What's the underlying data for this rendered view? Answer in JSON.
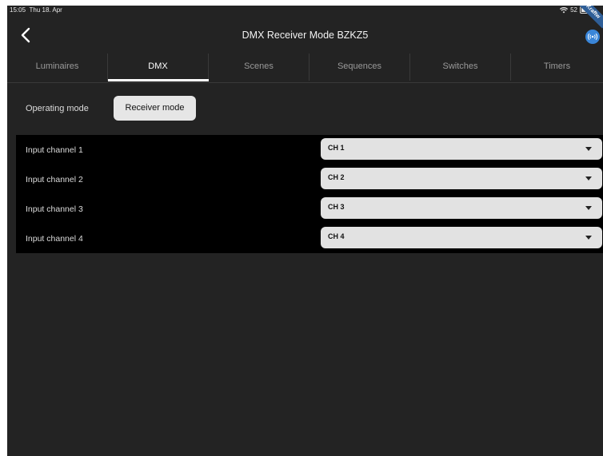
{
  "status_bar": {
    "time": "15:05",
    "date": "Thu 18. Apr",
    "battery": "52",
    "ribbon": "Kraftw"
  },
  "nav": {
    "title": "DMX Receiver Mode BZKZ5"
  },
  "tabs": [
    {
      "label": "Luminaires"
    },
    {
      "label": "DMX"
    },
    {
      "label": "Scenes"
    },
    {
      "label": "Sequences"
    },
    {
      "label": "Switches"
    },
    {
      "label": "Timers"
    }
  ],
  "active_tab": "DMX",
  "operating_mode": {
    "label": "Operating mode",
    "value": "Receiver mode"
  },
  "channels": [
    {
      "label": "Input channel 1",
      "value": "CH 1"
    },
    {
      "label": "Input channel 2",
      "value": "CH 2"
    },
    {
      "label": "Input channel 3",
      "value": "CH 3"
    },
    {
      "label": "Input channel 4",
      "value": "CH 4"
    }
  ],
  "colors": {
    "background": "#232323",
    "panel": "#000000",
    "accent": "#3a86d9",
    "control": "#e2e2e2"
  },
  "icons": [
    "back-chevron-icon",
    "broadcast-icon",
    "wifi-icon",
    "battery-icon"
  ]
}
